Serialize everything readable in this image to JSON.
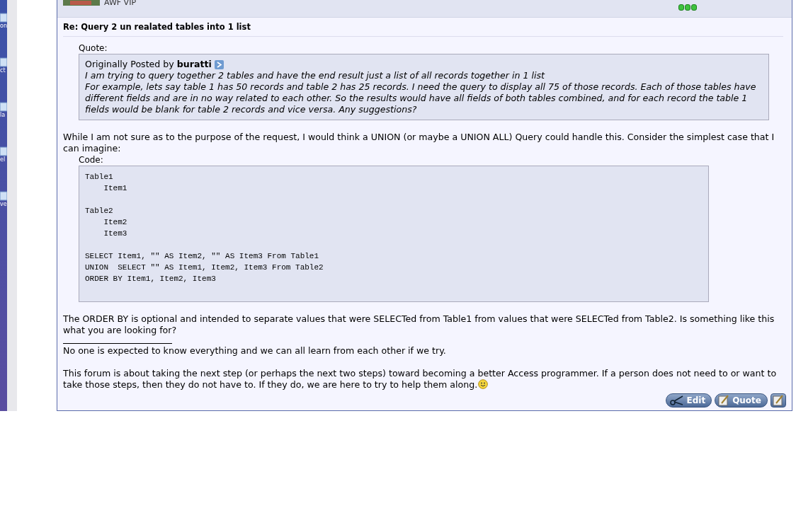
{
  "desktop": {
    "icon_labels": [
      "on",
      "ct",
      "la",
      "el",
      "ve"
    ]
  },
  "post": {
    "user_rank": "AWF VIP",
    "title": "Re: Query 2 un realated tables into 1 list",
    "quote": {
      "label": "Quote:",
      "intro": "Originally Posted by **buratti**",
      "lines": [
        "I am trying to query together 2 tables and have the end result just a list of all records together in 1 list",
        "For example, lets say table 1 has 50 records and table 2 has 25 records. I need the query to display all 75 of those records. Each of those tables have different fields and are in no way related to each other. So the results would have all fields of both tables combined, and for each record the table 1 fields would be blank for table 2 records and vice versa. Any suggestions?"
      ]
    },
    "body_before": "While I am not sure as to the purpose of the request, I would think a UNION (or maybe a UNION ALL) Query could handle this. Consider the simplest case that I can imagine:",
    "code": {
      "label": "Code:",
      "blocks": [
        [
          "Table1",
          "    Item1"
        ],
        [
          "Table2",
          "    Item2",
          "    Item3"
        ],
        [
          "SELECT Item1, \"\" AS Item2, \"\" AS Item3 From Table1",
          "UNION  SELECT \"\" AS Item1, Item2, Item3 From Table2",
          "ORDER BY Item1, Item2, Item3"
        ]
      ]
    },
    "body_after": "The ORDER BY is optional and intended to separate values that were SELECTed from Table1 from values that were SELECTed from Table2. Is something like this what you are looking for?",
    "signature": [
      "No one is expected to know everything and we can all learn from each other if we try.",
      "This forum is about taking the next step (or perhaps the next two steps) toward becoming a better Access programmer. If a person does not need to or want to take those steps, then they do not have to. If they do, we are here to try to help them along."
    ],
    "buttons": [
      {
        "kind": "edit",
        "label": "Edit"
      },
      {
        "kind": "quote",
        "label": "Quote"
      },
      {
        "kind": "quick-reply"
      }
    ]
  }
}
